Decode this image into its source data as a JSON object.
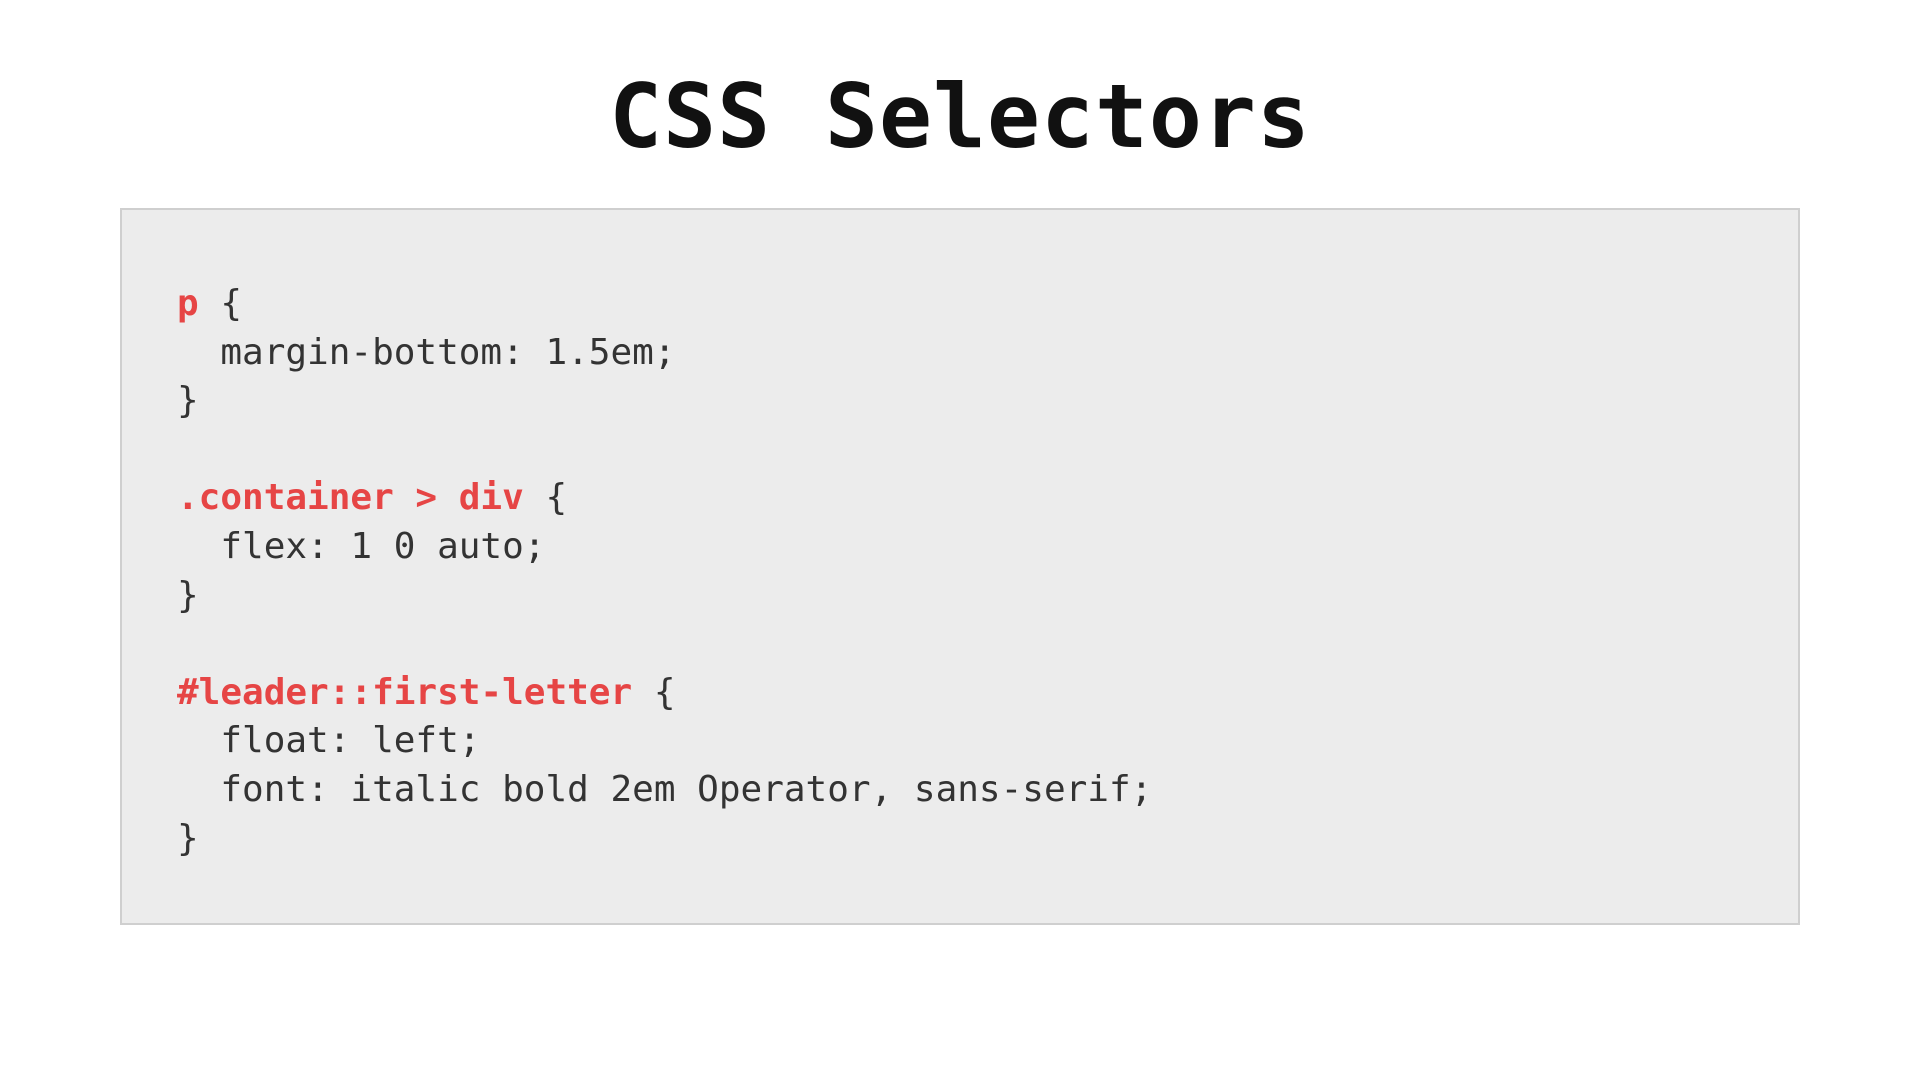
{
  "title": "CSS Selectors",
  "colors": {
    "selector": "#e64545",
    "code_bg": "#ececec",
    "code_border": "#cfcfcf",
    "text": "#333333"
  },
  "code": {
    "rule1": {
      "selector": "p",
      "open": " {",
      "line1": "  margin-bottom: 1.5em;",
      "close": "}"
    },
    "rule2": {
      "selector": ".container > div",
      "open": " {",
      "line1": "  flex: 1 0 auto;",
      "close": "}"
    },
    "rule3": {
      "selector": "#leader::first-letter",
      "open": " {",
      "line1": "  float: left;",
      "line2": "  font: italic bold 2em Operator, sans-serif;",
      "close": "}"
    },
    "blank": ""
  }
}
